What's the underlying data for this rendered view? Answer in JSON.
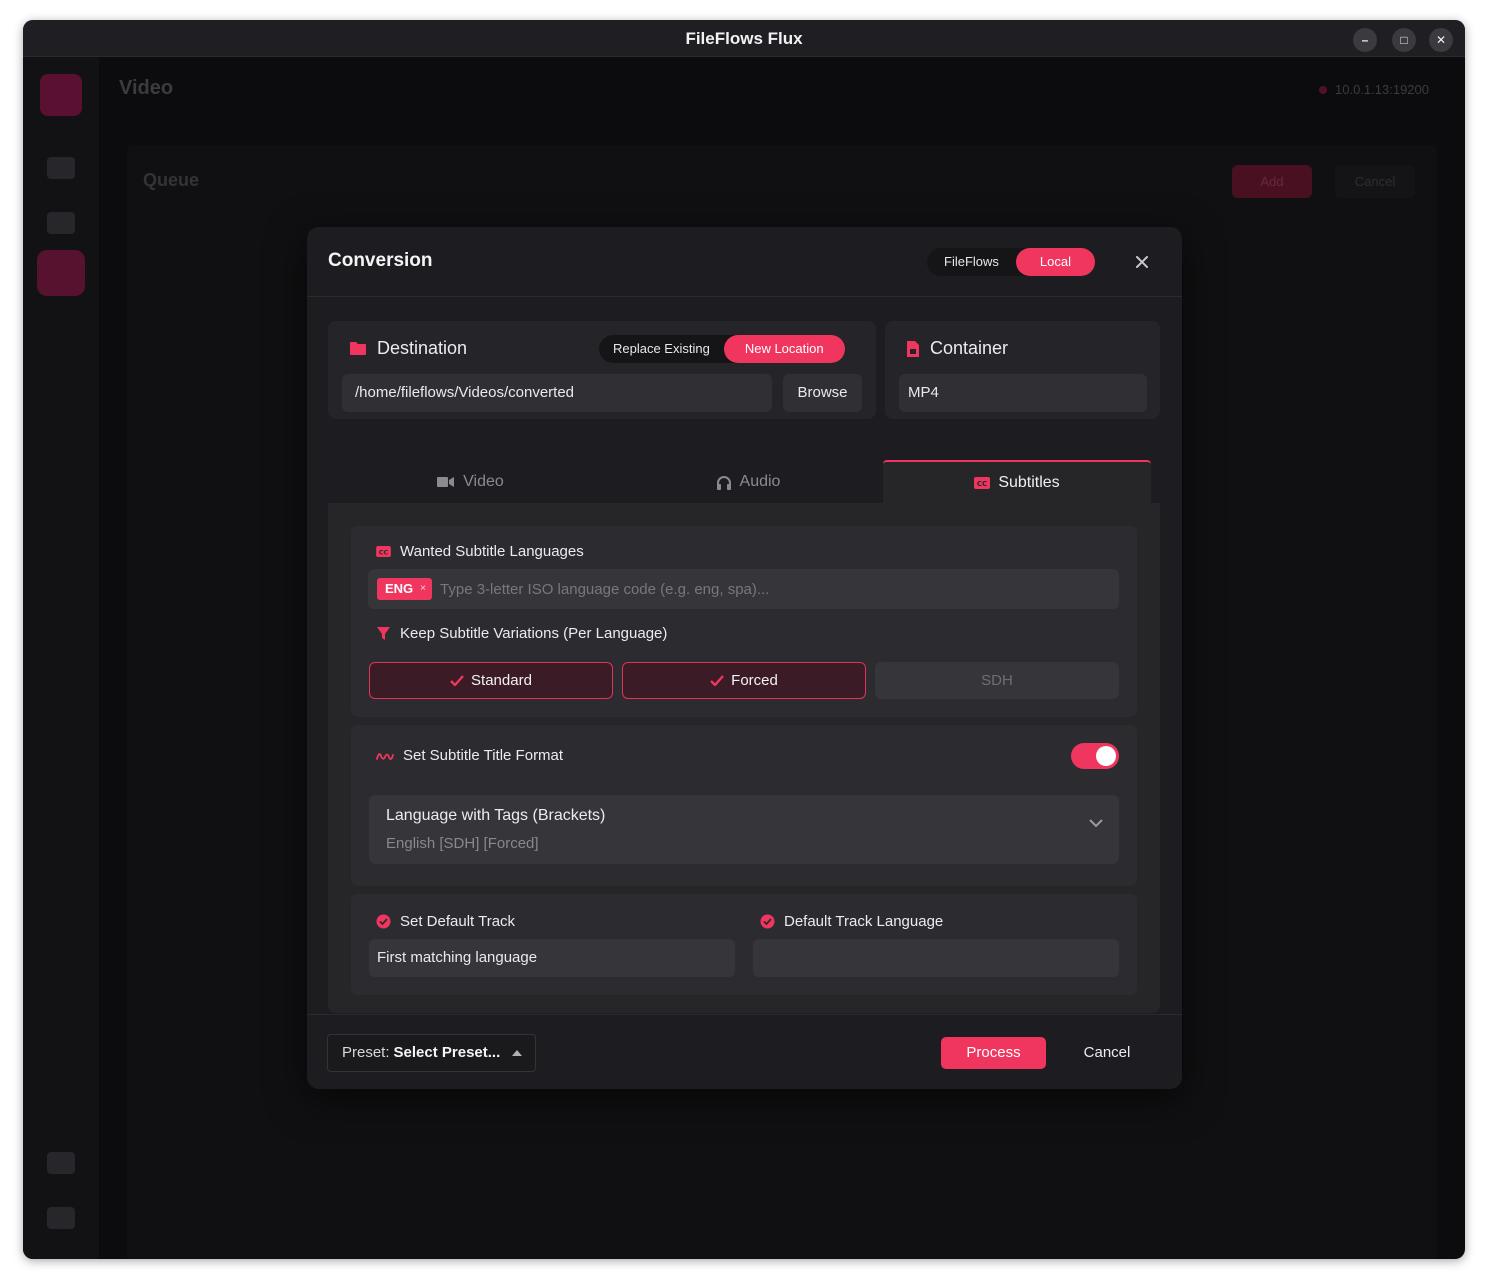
{
  "window": {
    "title": "FileFlows Flux",
    "minimize": "–",
    "maximize": "□",
    "close": "✕"
  },
  "background": {
    "header": "Video",
    "server": "10.0.1.13:19200",
    "queue_title": "Queue",
    "add_label": "Add",
    "cancel_label": "Cancel"
  },
  "modal": {
    "title": "Conversion",
    "source_toggle": {
      "options": [
        "FileFlows",
        "Local"
      ],
      "selected": "Local"
    },
    "destination": {
      "title": "Destination",
      "modes": [
        "Replace Existing",
        "New Location"
      ],
      "selected_mode": "New Location",
      "path": "/home/fileflows/Videos/converted",
      "browse_label": "Browse"
    },
    "container": {
      "title": "Container",
      "value": "MP4"
    },
    "tabs": [
      {
        "label": "Video",
        "icon": "video-camera-icon"
      },
      {
        "label": "Audio",
        "icon": "headphones-icon"
      },
      {
        "label": "Subtitles",
        "icon": "closed-captions-icon"
      }
    ],
    "active_tab": "Subtitles",
    "subtitles": {
      "wanted_label": "Wanted Subtitle Languages",
      "languages": [
        {
          "code": "ENG",
          "remove": "×"
        }
      ],
      "language_placeholder": "Type 3-letter ISO language code (e.g. eng, spa)...",
      "variations_label": "Keep Subtitle Variations (Per Language)",
      "variations": [
        {
          "label": "Standard",
          "checked": true
        },
        {
          "label": "Forced",
          "checked": true
        },
        {
          "label": "SDH",
          "checked": false
        }
      ],
      "title_format_label": "Set Subtitle Title Format",
      "title_format_enabled": true,
      "title_format_value": "Language with Tags (Brackets)",
      "title_format_example": "English [SDH] [Forced]",
      "default_track_label": "Set Default Track",
      "default_track_value": "First matching language",
      "default_language_label": "Default Track Language",
      "default_language_value": ""
    },
    "footer": {
      "preset_prefix": "Preset:",
      "preset_value": "Select Preset...",
      "process_label": "Process",
      "cancel_label": "Cancel"
    }
  },
  "colors": {
    "accent": "#f0365f",
    "modal_bg": "#1d1d21",
    "window_bg": "#0c0c0e"
  }
}
